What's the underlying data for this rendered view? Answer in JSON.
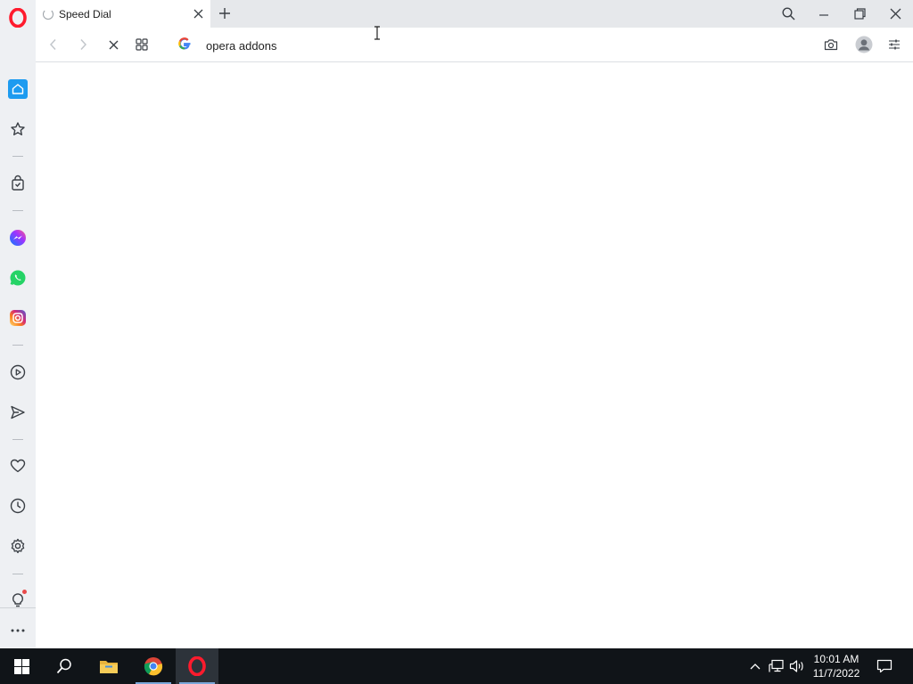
{
  "tab": {
    "title": "Speed Dial"
  },
  "addressbar": {
    "url": "opera addons"
  },
  "sidebar": {
    "items": [
      {
        "icon": "home-icon",
        "active": true
      },
      {
        "icon": "star-icon"
      },
      {
        "icon": "shopping-bag-icon"
      },
      {
        "icon": "messenger-icon"
      },
      {
        "icon": "whatsapp-icon"
      },
      {
        "icon": "instagram-icon"
      },
      {
        "icon": "player-icon"
      },
      {
        "icon": "send-icon"
      },
      {
        "icon": "heart-icon"
      },
      {
        "icon": "history-icon"
      },
      {
        "icon": "settings-icon"
      },
      {
        "icon": "bulb-icon"
      },
      {
        "icon": "more-icon"
      }
    ]
  },
  "taskbar": {
    "apps": [
      "start-icon",
      "search-icon",
      "file-explorer-icon",
      "chrome-icon",
      "opera-icon"
    ],
    "clock": {
      "time": "10:01 AM",
      "date": "11/7/2022"
    }
  },
  "colors": {
    "accent": "#1d9bf0",
    "opera_red": "#ff1b2d",
    "taskbar": "#101418"
  }
}
